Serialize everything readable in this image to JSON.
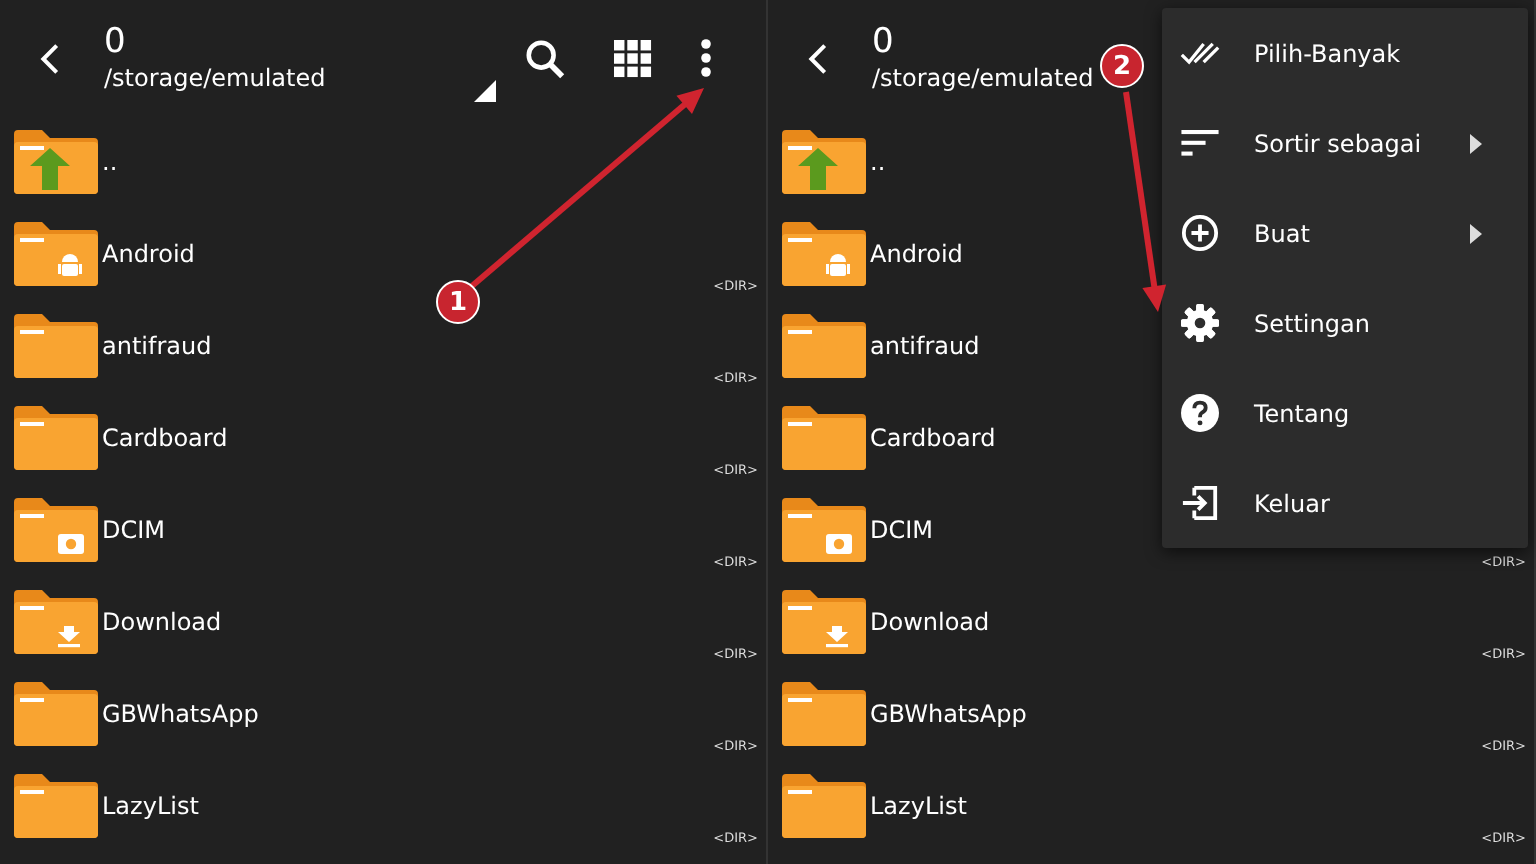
{
  "panels": [
    {
      "toolbar": {
        "title": "0",
        "path": "/storage/emulated",
        "actions": [
          {
            "kind": "search"
          },
          {
            "kind": "grid"
          },
          {
            "kind": "more"
          }
        ],
        "sort_indicator": true
      },
      "files": [
        {
          "name": "..",
          "kind": "up"
        },
        {
          "name": "Android",
          "kind": "android",
          "tag": "<DIR>"
        },
        {
          "name": "antifraud",
          "kind": "plain",
          "tag": "<DIR>"
        },
        {
          "name": "Cardboard",
          "kind": "plain",
          "tag": "<DIR>"
        },
        {
          "name": "DCIM",
          "kind": "camera",
          "tag": "<DIR>"
        },
        {
          "name": "Download",
          "kind": "download",
          "tag": "<DIR>"
        },
        {
          "name": "GBWhatsApp",
          "kind": "plain",
          "tag": "<DIR>"
        },
        {
          "name": "LazyList",
          "kind": "plain",
          "tag": "<DIR>"
        }
      ]
    },
    {
      "toolbar": {
        "title": "0",
        "path": "/storage/emulated",
        "sort_indicator": false
      },
      "files": [
        {
          "name": "..",
          "kind": "up"
        },
        {
          "name": "Android",
          "kind": "android"
        },
        {
          "name": "antifraud",
          "kind": "plain"
        },
        {
          "name": "Cardboard",
          "kind": "plain"
        },
        {
          "name": "DCIM",
          "kind": "camera",
          "tag": "<DIR>"
        },
        {
          "name": "Download",
          "kind": "download",
          "tag": "<DIR>"
        },
        {
          "name": "GBWhatsApp",
          "kind": "plain",
          "tag": "<DIR>"
        },
        {
          "name": "LazyList",
          "kind": "plain",
          "tag": "<DIR>"
        }
      ],
      "menu": {
        "items": [
          {
            "label": "Pilih-Banyak",
            "kind": "multiselect",
            "submenu": false
          },
          {
            "label": "Sortir sebagai",
            "kind": "sort",
            "submenu": true
          },
          {
            "label": "Buat",
            "kind": "create",
            "submenu": true
          },
          {
            "label": "Settingan",
            "kind": "settings",
            "submenu": false
          },
          {
            "label": "Tentang",
            "kind": "about",
            "submenu": false
          },
          {
            "label": "Keluar",
            "kind": "exit",
            "submenu": false
          }
        ]
      }
    }
  ],
  "annotations": [
    {
      "number": "1"
    },
    {
      "number": "2"
    }
  ]
}
